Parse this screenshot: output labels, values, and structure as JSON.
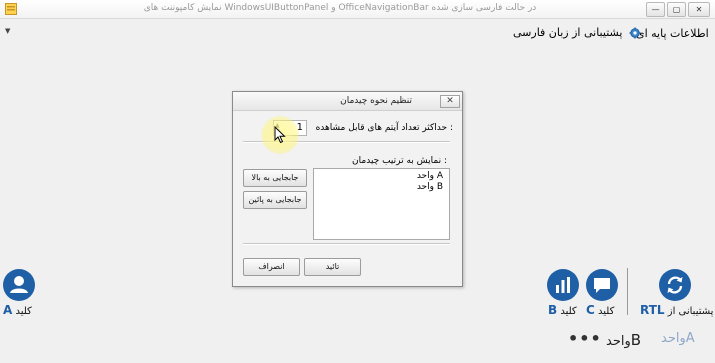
{
  "window": {
    "title": "نمایش کامپوننت های WindowsUIButtonPanel و OfficeNavigationBar در حالت فارسی سازی شده",
    "minimize_glyph": "—",
    "maximize_glyph": "▢",
    "close_glyph": "✕"
  },
  "top_nav": {
    "left_arrow": "▼",
    "items": [
      {
        "label": "اطلاعات پایه ای"
      },
      {
        "label": "پشتیبانی از زبان فارسی",
        "icon": "gear-icon"
      }
    ]
  },
  "dialog": {
    "title": "تنظیم نحوه چیدمان",
    "close_glyph": "✕",
    "max_items_label": "حداکثر تعداد آیتم های قابل مشاهده :",
    "max_items_value": "1",
    "order_label": "نمایش به ترتیب چیدمان :",
    "order_items": [
      "واحد A",
      "واحد B"
    ],
    "move_up_label": "جابجایی به بالا",
    "move_down_label": "جابجایی به پائین",
    "cancel_label": "انصراف",
    "ok_label": "تائید"
  },
  "bottom_buttons": {
    "left": {
      "label": "کلید",
      "letter": "A",
      "icon": "user-icon"
    },
    "right": [
      {
        "label": "کلید",
        "letter": "B",
        "icon": "bar-chart-icon"
      },
      {
        "label": "کلید",
        "letter": "C",
        "icon": "chat-icon"
      },
      {
        "label": "پشتیبانی از",
        "letter": "RTL",
        "icon": "sync-icon"
      }
    ]
  },
  "bottom_nav": {
    "items": [
      {
        "label": "واحد",
        "letter": "A",
        "state": "selected"
      },
      {
        "label": "واحد",
        "letter": "B",
        "state": "normal"
      }
    ],
    "more": "•••"
  },
  "colors": {
    "accent": "#1f5fa6",
    "selected_nav_text": "#8fa8c8"
  }
}
